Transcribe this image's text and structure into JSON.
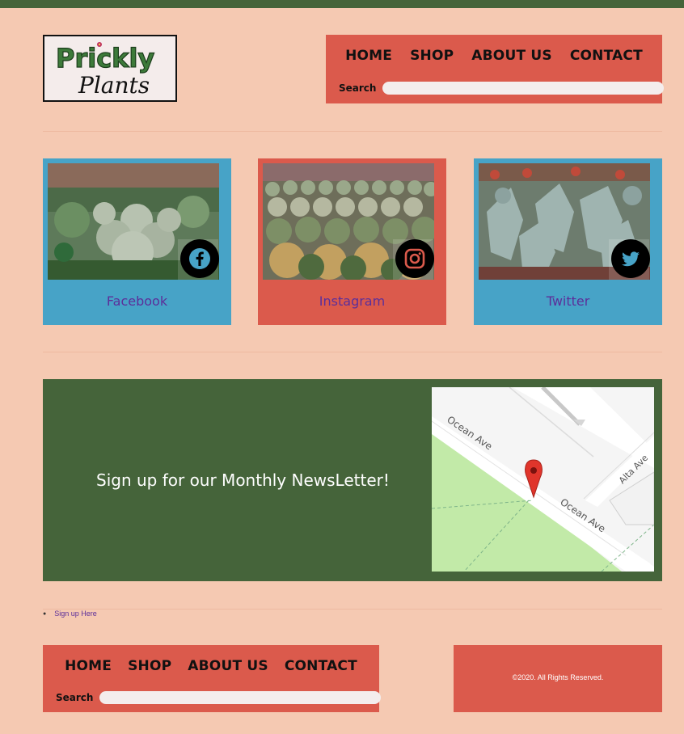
{
  "logo": {
    "line1": "Prickly",
    "line2": "Plants"
  },
  "nav_top": {
    "links": [
      "HOME",
      "SHOP",
      "ABOUT US",
      "CONTACT"
    ],
    "search_label": "Search",
    "search_value": ""
  },
  "social": {
    "facebook": {
      "label": "Facebook",
      "icon": "facebook-icon"
    },
    "instagram": {
      "label": "Instagram",
      "icon": "instagram-icon"
    },
    "twitter": {
      "label": "Twitter",
      "icon": "twitter-icon"
    }
  },
  "newsletter": {
    "headline": "Sign up for our Monthly NewsLetter!",
    "map": {
      "street1": "Ocean Ave",
      "street2": "Ocean Ave",
      "street3": "Alta Ave"
    }
  },
  "signup_list": {
    "items": [
      "Sign up Here"
    ]
  },
  "nav_bottom": {
    "links": [
      "HOME",
      "SHOP",
      "ABOUT US",
      "CONTACT"
    ],
    "search_label": "Search",
    "search_value": ""
  },
  "footer": {
    "copyright": "©2020. All Rights Reserved."
  },
  "colors": {
    "page_bg": "#f5c9b2",
    "dark_green": "#45643a",
    "coral": "#db5a4c",
    "blue": "#47a3c7",
    "link_purple": "#5c2f9a"
  }
}
